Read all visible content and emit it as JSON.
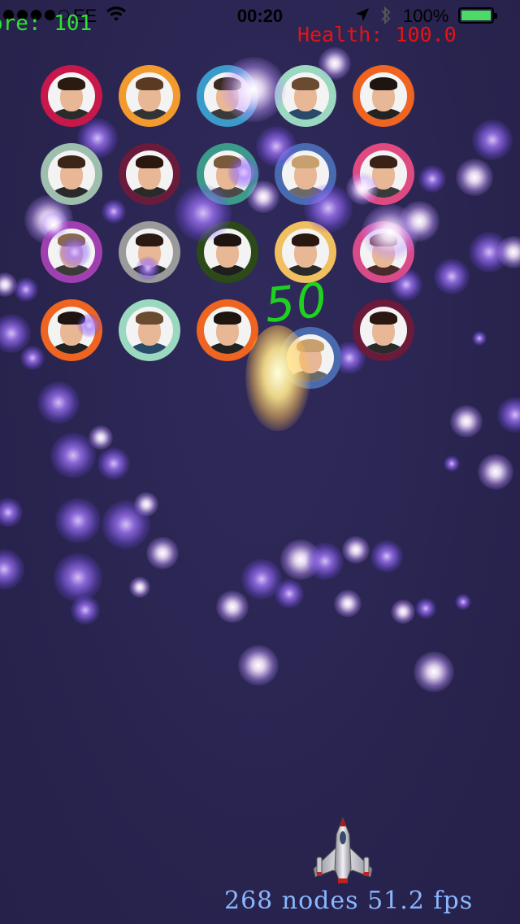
{
  "status_bar": {
    "carrier": "EE",
    "time": "00:20",
    "battery_percent": "100%",
    "signal_icon": "signal-dots-icon",
    "wifi_icon": "wifi-icon",
    "location_icon": "location-arrow-icon",
    "bluetooth_icon": "bluetooth-icon",
    "battery_icon": "battery-icon"
  },
  "hud": {
    "score": "ore: 101",
    "health": "Health: 100.0",
    "stats": "268 nodes 51.2 fps"
  },
  "popup": {
    "points": "50"
  },
  "colors": {
    "background": "#2a2550",
    "score": "#2ee52e",
    "health": "#e51414",
    "stats": "#8ab7ff",
    "popup": "#1fd21f",
    "battery": "#4cd964"
  },
  "enemies": [
    {
      "row": 1,
      "col": 1,
      "ring": "#c8174a",
      "hair": "#2b1a12",
      "shirt": "#2b2b2b"
    },
    {
      "row": 1,
      "col": 2,
      "ring": "#f29a2e",
      "hair": "#5a3a22",
      "shirt": "#333333"
    },
    {
      "row": 1,
      "col": 3,
      "ring": "#3a9ac9",
      "hair": "#3a2a20",
      "shirt": "#3a3a3a"
    },
    {
      "row": 1,
      "col": 4,
      "ring": "#9ad8c0",
      "hair": "#6a4a30",
      "shirt": "#2a4a6a"
    },
    {
      "row": 1,
      "col": 5,
      "ring": "#ee6420",
      "hair": "#1e1410",
      "shirt": "#222222"
    },
    {
      "row": 2,
      "col": 1,
      "ring": "#9fbfae",
      "hair": "#3b2418",
      "shirt": "#2a2a2a"
    },
    {
      "row": 2,
      "col": 2,
      "ring": "#6a1a3a",
      "hair": "#2a1810",
      "shirt": "#2a2a2a"
    },
    {
      "row": 2,
      "col": 3,
      "ring": "#3c9a8a",
      "hair": "#7a5a3a",
      "shirt": "#4a4a4a"
    },
    {
      "row": 2,
      "col": 4,
      "ring": "#4a6ab0",
      "hair": "#c8a070",
      "shirt": "#6a6a6a"
    },
    {
      "row": 2,
      "col": 5,
      "ring": "#e04a82",
      "hair": "#3a2218",
      "shirt": "#3a3a3a"
    },
    {
      "row": 3,
      "col": 1,
      "ring": "#a040b0",
      "hair": "#8a6a4a",
      "shirt": "#3a3a3a"
    },
    {
      "row": 3,
      "col": 2,
      "ring": "#9a9a9a",
      "hair": "#2a1a12",
      "shirt": "#2a2a2a"
    },
    {
      "row": 3,
      "col": 3,
      "ring": "#2c4a18",
      "hair": "#1e1410",
      "shirt": "#1e1e1e"
    },
    {
      "row": 3,
      "col": 4,
      "ring": "#f0c060",
      "hair": "#2a1810",
      "shirt": "#2a2a2a"
    },
    {
      "row": 3,
      "col": 5,
      "ring": "#d84a8a",
      "hair": "#6a3a22",
      "shirt": "#4a2a2a"
    },
    {
      "row": 4,
      "col": 1,
      "ring": "#ee6420",
      "hair": "#1e1410",
      "shirt": "#222222"
    },
    {
      "row": 4,
      "col": 2,
      "ring": "#9ad8c0",
      "hair": "#6a4a30",
      "shirt": "#2a4a6a"
    },
    {
      "row": 4,
      "col": 3,
      "ring": "#ee6420",
      "hair": "#1e1410",
      "shirt": "#222222"
    },
    {
      "row": 4,
      "col": 4,
      "ring": "#4a6ab0",
      "hair": "#c8a070",
      "shirt": "#6a6a6a"
    },
    {
      "row": 4,
      "col": 5,
      "ring": "#6a1a3a",
      "hair": "#2a1810",
      "shirt": "#2a2a2a"
    }
  ],
  "player": {
    "icon": "spaceship-icon"
  }
}
